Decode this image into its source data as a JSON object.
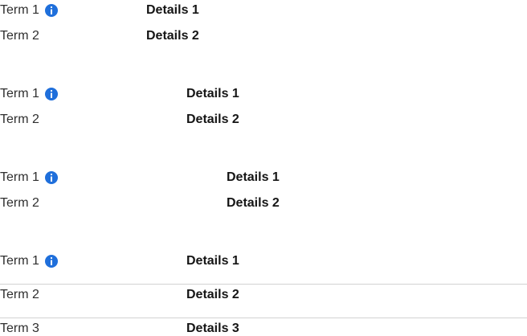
{
  "colors": {
    "info_icon": "#1f6fdb",
    "divider": "#d2d2d2"
  },
  "groups": [
    {
      "rows": [
        {
          "term": "Term 1",
          "details": "Details 1",
          "icon": "info-icon"
        },
        {
          "term": "Term 2",
          "details": "Details 2"
        }
      ]
    },
    {
      "rows": [
        {
          "term": "Term 1",
          "details": "Details 1",
          "icon": "info-icon"
        },
        {
          "term": "Term 2",
          "details": "Details 2"
        }
      ]
    },
    {
      "rows": [
        {
          "term": "Term 1",
          "details": "Details 1",
          "icon": "info-icon"
        },
        {
          "term": "Term 2",
          "details": "Details 2"
        }
      ]
    },
    {
      "rows": [
        {
          "term": "Term 1",
          "details": "Details 1",
          "icon": "info-icon"
        },
        {
          "term": "Term 2",
          "details": "Details 2"
        },
        {
          "term": "Term 3",
          "details": "Details 3"
        }
      ]
    }
  ]
}
